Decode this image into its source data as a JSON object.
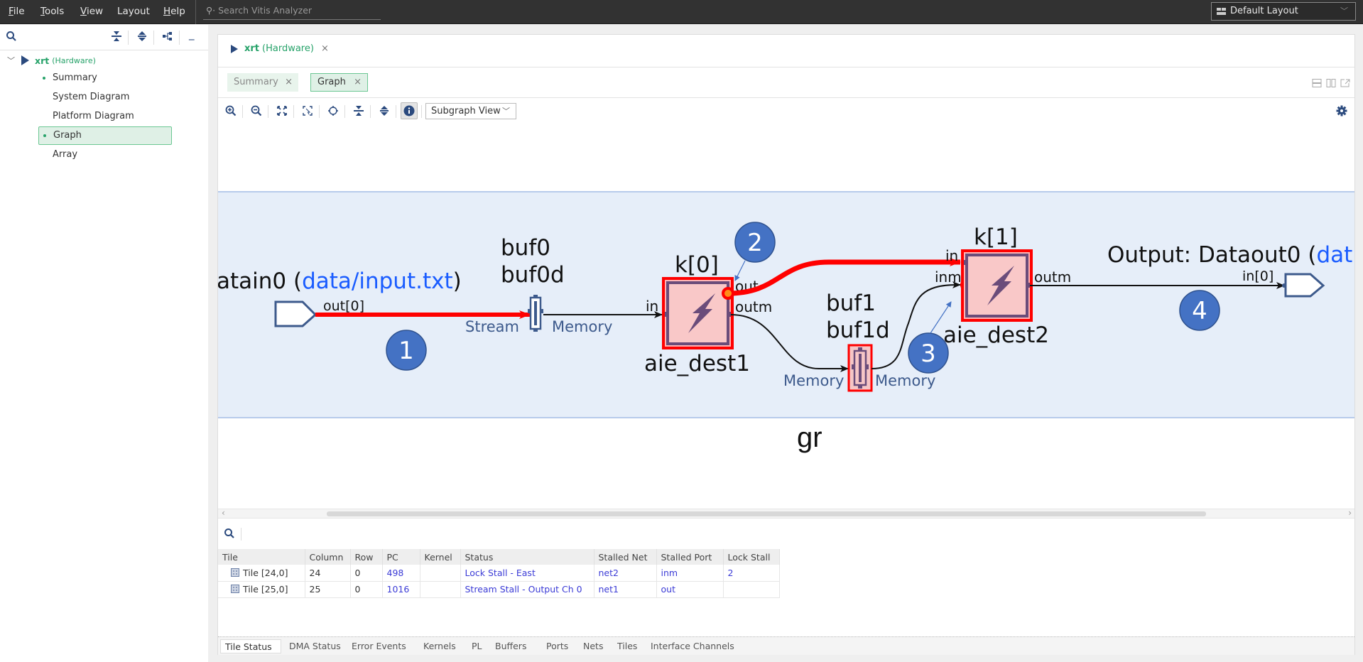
{
  "menu": {
    "items": [
      {
        "label": "File",
        "mnemonic": "F",
        "rest": "ile"
      },
      {
        "label": "Tools",
        "mnemonic": "T",
        "rest": "ools"
      },
      {
        "label": "View",
        "mnemonic": "V",
        "rest": "iew"
      },
      {
        "label": "Layout",
        "mnemonic": "",
        "rest": "Layout"
      },
      {
        "label": "Help",
        "mnemonic": "H",
        "rest": "elp"
      }
    ],
    "search_placeholder": "Search Vitis Analyzer",
    "layout_select": "Default Layout"
  },
  "sidebar": {
    "root": {
      "name": "xrt",
      "sub": "(Hardware)"
    },
    "items": [
      {
        "label": "Summary",
        "dot": true,
        "selected": false
      },
      {
        "label": "System Diagram",
        "dot": false,
        "selected": false
      },
      {
        "label": "Platform Diagram",
        "dot": false,
        "selected": false
      },
      {
        "label": "Graph",
        "dot": true,
        "selected": true
      },
      {
        "label": "Array",
        "dot": false,
        "selected": false
      }
    ]
  },
  "main": {
    "run_tab": {
      "name": "xrt",
      "sub": "(Hardware)",
      "close": "×"
    },
    "tabs": [
      {
        "label": "Summary",
        "close": "×",
        "active": false
      },
      {
        "label": "Graph",
        "close": "×",
        "active": true
      }
    ],
    "toolbar": {
      "buttons": [
        "zoom-in",
        "zoom-out",
        "fit-to-view",
        "zoom-to-selection",
        "center",
        "collapse-all",
        "expand-all",
        "info"
      ],
      "view_select": "Subgraph View"
    }
  },
  "graph": {
    "subgraph_name": "gr",
    "input": {
      "label_prefix": "atain0 (",
      "link": "data/input.txt",
      "label_suffix": ")",
      "port": "out[0]"
    },
    "output": {
      "label_prefix": "Output: Dataout0 (",
      "link": "dat",
      "port": "in[0]"
    },
    "buffers": [
      {
        "name": "buf0",
        "alias": "buf0d",
        "left_label": "Stream",
        "right_label": "Memory",
        "highlighted": false
      },
      {
        "name": "buf1",
        "alias": "buf1d",
        "left_label": "Memory",
        "right_label": "Memory",
        "highlighted": true
      }
    ],
    "kernels": [
      {
        "name": "k[0]",
        "instance": "aie_dest1",
        "ports": {
          "in": "in",
          "out": "out",
          "outm": "outm"
        }
      },
      {
        "name": "k[1]",
        "instance": "aie_dest2",
        "ports": {
          "in": "in",
          "inm": "inm",
          "outm": "outm"
        }
      }
    ],
    "callouts": [
      "1",
      "2",
      "3",
      "4"
    ],
    "colors": {
      "stall": "#ff0000",
      "band": "#e6eef9",
      "callout": "#4472c4",
      "kernel_fill": "#f9c8c8",
      "kernel_border": "#6a4c7a",
      "port_outline": "#3d5a8c"
    }
  },
  "tile_status": {
    "columns": [
      "Tile",
      "Column",
      "Row",
      "PC",
      "Kernel",
      "Status",
      "Stalled Net",
      "Stalled Port",
      "Lock Stall"
    ],
    "rows": [
      {
        "tile": "Tile [24,0]",
        "column": "24",
        "row": "0",
        "pc": "498",
        "kernel": "",
        "status": "Lock Stall - East",
        "stalled_net": "net2",
        "stalled_port": "inm",
        "lock_stall": "2"
      },
      {
        "tile": "Tile [25,0]",
        "column": "25",
        "row": "0",
        "pc": "1016",
        "kernel": "",
        "status": "Stream Stall - Output Ch 0",
        "stalled_net": "net1",
        "stalled_port": "out",
        "lock_stall": ""
      }
    ]
  },
  "bottom_tabs": [
    "Tile Status",
    "DMA Status",
    "Error Events",
    "Kernels",
    "PL",
    "Buffers",
    "Ports",
    "Nets",
    "Tiles",
    "Interface Channels"
  ]
}
